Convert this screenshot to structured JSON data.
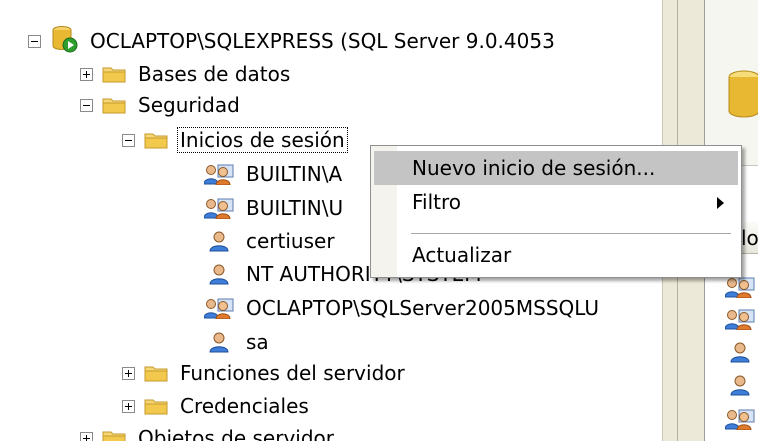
{
  "tree": {
    "server": {
      "label": "OCLAPTOP\\SQLEXPRESS (SQL Server 9.0.4053",
      "icon": "server-running-icon"
    },
    "databases": {
      "label": "Bases de datos",
      "icon": "folder-icon"
    },
    "security": {
      "label": "Seguridad",
      "icon": "folder-icon"
    },
    "logins": {
      "label": "Inicios de sesión",
      "icon": "folder-icon"
    },
    "login_items": [
      {
        "label": "BUILTIN\\A",
        "icon": "group-login-icon"
      },
      {
        "label": "BUILTIN\\U",
        "icon": "group-login-icon"
      },
      {
        "label": "certiuser",
        "icon": "user-login-icon"
      },
      {
        "label": "NT AUTHORITY\\SYSTEM",
        "icon": "user-login-icon"
      },
      {
        "label": "OCLAPTOP\\SQLServer2005MSSQLU",
        "icon": "group-login-icon"
      },
      {
        "label": "sa",
        "icon": "user-login-icon"
      }
    ],
    "server_roles": {
      "label": "Funciones del servidor",
      "icon": "folder-icon"
    },
    "credentials": {
      "label": "Credenciales",
      "icon": "folder-icon"
    },
    "server_objects": {
      "label": "Objetos de servidor",
      "icon": "folder-icon"
    }
  },
  "context_menu": {
    "new_login": "Nuevo inicio de sesión...",
    "filter": "Filtro",
    "refresh": "Actualizar"
  },
  "right_pane": {
    "column_header": "lo"
  },
  "colors": {
    "folder": "#f2c94c",
    "menu_highlight": "#c4c4c4",
    "server_green": "#2e9e2e"
  }
}
